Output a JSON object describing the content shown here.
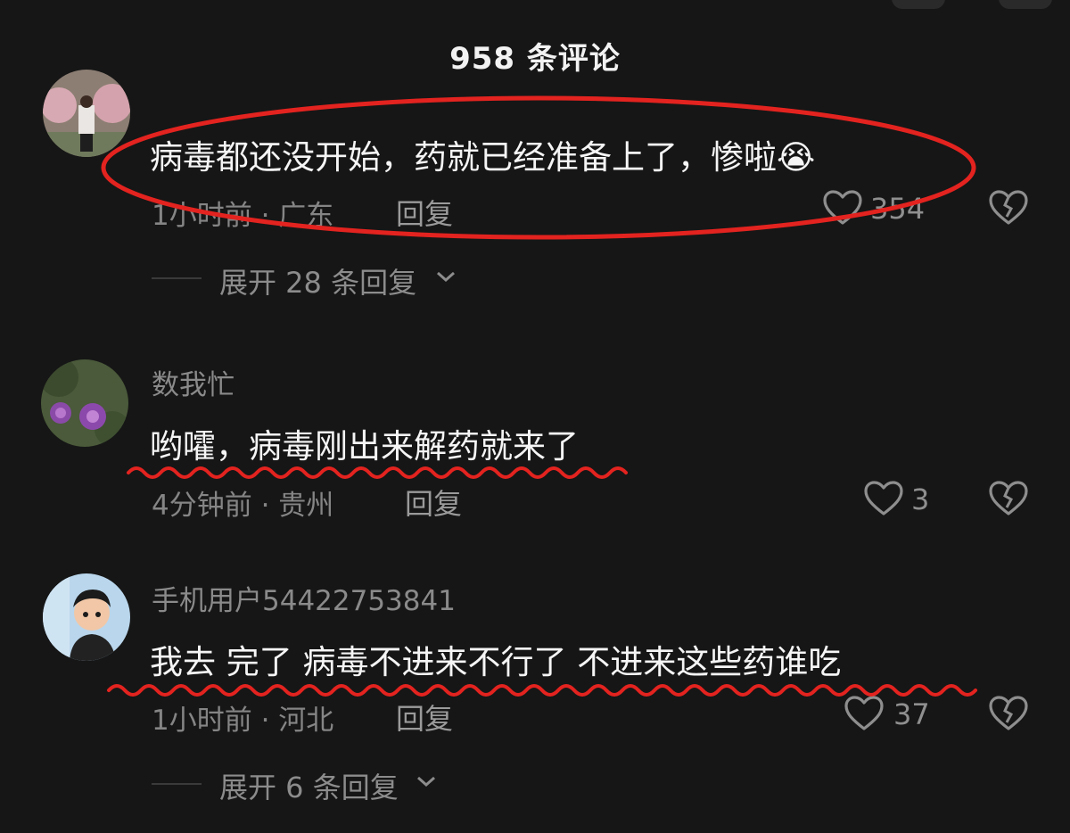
{
  "header": {
    "title": "958 条评论"
  },
  "comments": [
    {
      "text": "病毒都还没开始，药就已经准备上了，惨啦",
      "emoji": "😭",
      "meta": "1小时前 · 广东",
      "reply_label": "回复",
      "likes": "354",
      "expand_label": "展开 28 条回复"
    },
    {
      "username": "数我忙",
      "text": "哟嚯，病毒刚出来解药就来了",
      "meta": "4分钟前 · 贵州",
      "reply_label": "回复",
      "likes": "3"
    },
    {
      "username": "手机用户54422753841",
      "text": "我去 完了 病毒不进来不行了 不进来这些药谁吃",
      "meta": "1小时前 · 河北",
      "reply_label": "回复",
      "likes": "37",
      "expand_label": "展开 6 条回复"
    }
  ],
  "icons": {
    "like": "heart-outline-icon",
    "dislike": "broken-heart-icon",
    "expand": "chevron-down-icon"
  },
  "colors": {
    "background": "#161616",
    "annotation_red": "#e3231f"
  }
}
